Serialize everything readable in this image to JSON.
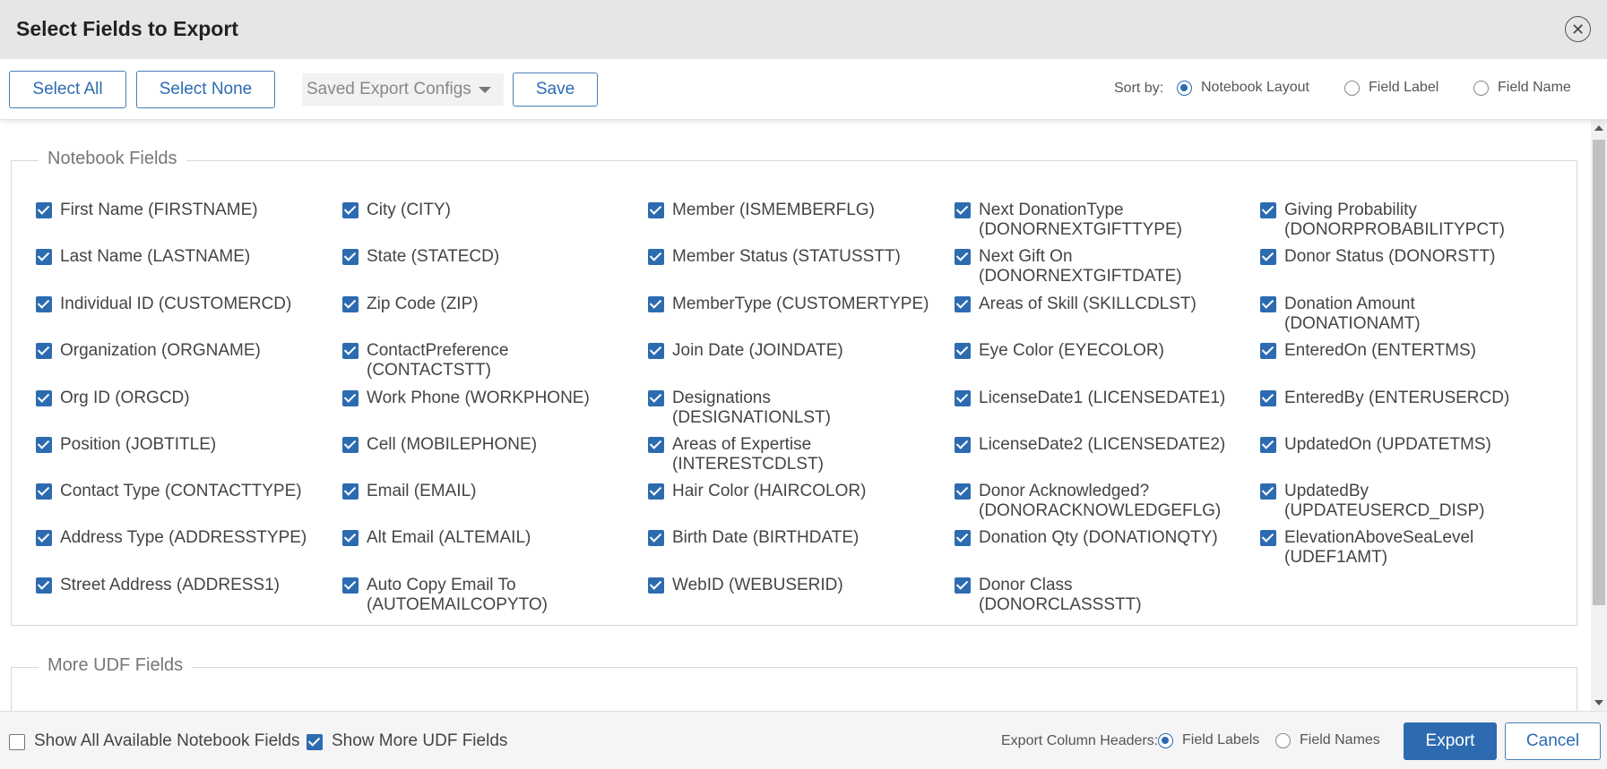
{
  "dialog": {
    "title": "Select Fields to Export",
    "close_icon": "close-icon"
  },
  "toolbar": {
    "select_all": "Select All",
    "select_none": "Select None",
    "saved_configs_placeholder": "Saved Export Configs",
    "save": "Save",
    "sort_by_label": "Sort by:",
    "sort_options": [
      {
        "label": "Notebook Layout",
        "selected": true
      },
      {
        "label": "Field Label",
        "selected": false
      },
      {
        "label": "Field Name",
        "selected": false
      }
    ]
  },
  "notebook_fields": {
    "legend": "Notebook Fields",
    "columns": [
      [
        "First Name (FIRSTNAME)",
        "Last Name (LASTNAME)",
        "Individual ID (CUSTOMERCD)",
        "Organization (ORGNAME)",
        "Org ID (ORGCD)",
        "Position (JOBTITLE)",
        "Contact Type (CONTACTTYPE)",
        "Address Type (ADDRESSTYPE)",
        "Street Address (ADDRESS1)"
      ],
      [
        "City (CITY)",
        "State (STATECD)",
        "Zip Code (ZIP)",
        "ContactPreference (CONTACTSTT)",
        "Work Phone (WORKPHONE)",
        "Cell (MOBILEPHONE)",
        "Email (EMAIL)",
        "Alt Email (ALTEMAIL)",
        "Auto Copy Email To (AUTOEMAILCOPYTO)"
      ],
      [
        "Member (ISMEMBERFLG)",
        "Member Status (STATUSSTT)",
        "MemberType (CUSTOMERTYPE)",
        "Join Date (JOINDATE)",
        "Designations (DESIGNATIONLST)",
        "Areas of Expertise (INTERESTCDLST)",
        "Hair Color (HAIRCOLOR)",
        "Birth Date (BIRTHDATE)",
        "WebID (WEBUSERID)"
      ],
      [
        "Next DonationType (DONORNEXTGIFTTYPE)",
        "Next Gift On (DONORNEXTGIFTDATE)",
        "Areas of Skill (SKILLCDLST)",
        "Eye Color (EYECOLOR)",
        "LicenseDate1 (LICENSEDATE1)",
        "LicenseDate2 (LICENSEDATE2)",
        "Donor Acknowledged? (DONORACKNOWLEDGEFLG)",
        "Donation Qty (DONATIONQTY)",
        "Donor Class (DONORCLASSSTT)"
      ],
      [
        "Giving Probability (DONORPROBABILITYPCT)",
        "Donor Status (DONORSTT)",
        "Donation Amount (DONATIONAMT)",
        "EnteredOn (ENTERTMS)",
        "EnteredBy (ENTERUSERCD)",
        "UpdatedOn (UPDATETMS)",
        "UpdatedBy (UPDATEUSERCD_DISP)",
        "ElevationAboveSeaLevel (UDEF1AMT)"
      ]
    ]
  },
  "more_udf": {
    "legend": "More UDF Fields"
  },
  "footer": {
    "show_all_notebook": "Show All Available Notebook Fields",
    "show_all_notebook_checked": false,
    "show_more_udf": "Show More UDF Fields",
    "show_more_udf_checked": true,
    "export_headers_label": "Export Column Headers:",
    "header_options": [
      {
        "label": "Field Labels",
        "selected": true
      },
      {
        "label": "Field Names",
        "selected": false
      }
    ],
    "export": "Export",
    "cancel": "Cancel"
  },
  "colors": {
    "accent": "#2d6bb0",
    "header_bg": "#e6e6e6"
  }
}
